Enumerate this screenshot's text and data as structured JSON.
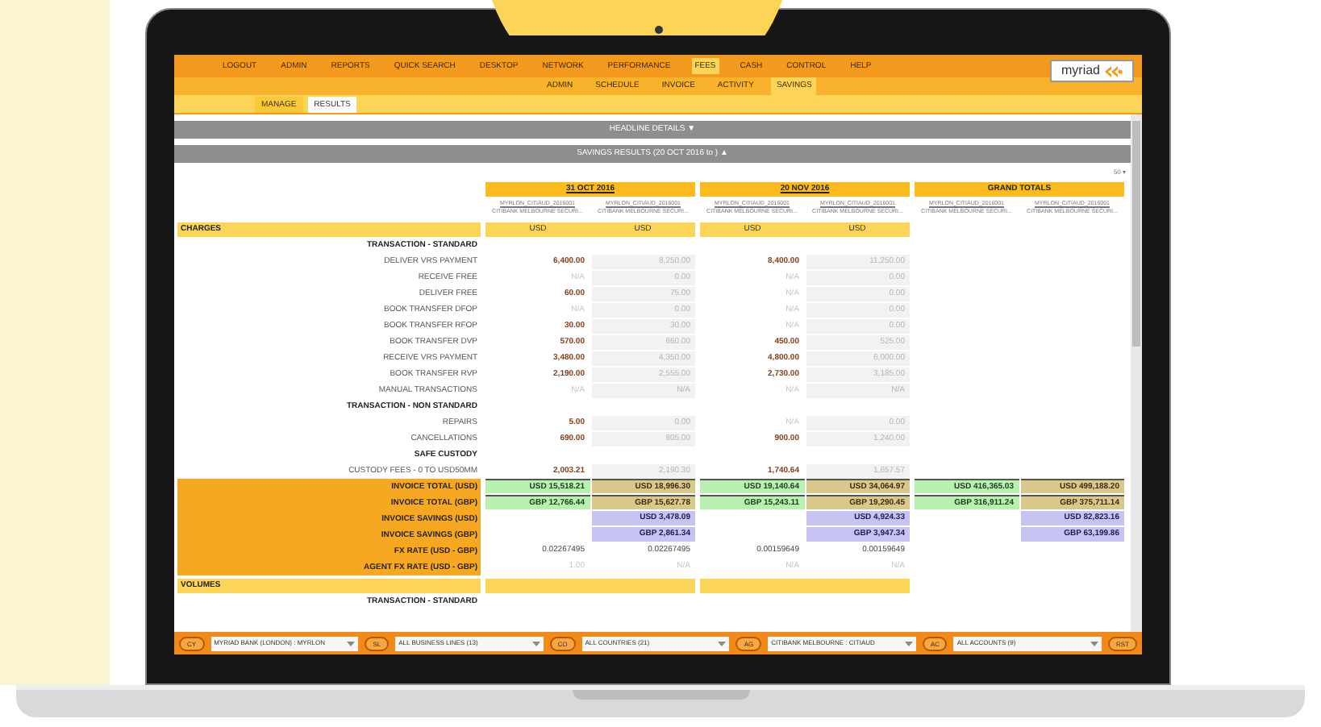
{
  "nav": [
    {
      "label": "LOGOUT",
      "selected": false
    },
    {
      "label": "ADMIN",
      "selected": false
    },
    {
      "label": "REPORTS",
      "selected": false
    },
    {
      "label": "QUICK SEARCH",
      "selected": false
    },
    {
      "label": "DESKTOP",
      "selected": false
    },
    {
      "label": "NETWORK",
      "selected": false
    },
    {
      "label": "PERFORMANCE",
      "selected": false
    },
    {
      "label": "FEES",
      "selected": true
    },
    {
      "label": "CASH",
      "selected": false
    },
    {
      "label": "CONTROL",
      "selected": false
    },
    {
      "label": "HELP",
      "selected": false
    }
  ],
  "subnav": [
    {
      "label": "ADMIN",
      "selected": false
    },
    {
      "label": "SCHEDULE",
      "selected": false
    },
    {
      "label": "INVOICE",
      "selected": false
    },
    {
      "label": "ACTIVITY",
      "selected": false
    },
    {
      "label": "SAVINGS",
      "selected": true
    }
  ],
  "tabs": [
    {
      "label": "MANAGE",
      "selected": false
    },
    {
      "label": "RESULTS",
      "selected": true
    }
  ],
  "logo": "myriad",
  "bars": [
    {
      "label": "HEADLINE DETAILS ▼"
    },
    {
      "label": "SAVINGS RESULTS (20 OCT 2016 to ) ▲"
    }
  ],
  "pager": "50 ▾",
  "groups": [
    {
      "title": "31 OCT 2016",
      "underlined": true
    },
    {
      "title": "20 NOV 2016",
      "underlined": true
    },
    {
      "title": "GRAND TOTALS",
      "underlined": false
    }
  ],
  "accounts": [
    {
      "code": "MYRLON_CITIAUD_2016001",
      "bank": "CITIBANK MELBOURNE SECURI..."
    },
    {
      "code": "MYRLON_CITIAUD_2016001",
      "bank": "CITIBANK MELBOURNE SECURI..."
    },
    {
      "code": "MYRLON_CITIAUD_2016001",
      "bank": "CITIBANK MELBOURNE SECURI..."
    },
    {
      "code": "MYRLON_CITIAUD_2016001",
      "bank": "CITIBANK MELBOURNE SECURI..."
    },
    {
      "code": "MYRLON_CITIAUD_2016001",
      "bank": "CITIBANK MELBOURNE SECURI..."
    },
    {
      "code": "MYRLON_CITIAUD_2016001",
      "bank": "CITIBANK MELBOURNE SECURI..."
    }
  ],
  "rows": [
    {
      "kind": "section",
      "label": "CHARGES",
      "cells": [
        "USD",
        "USD",
        "USD",
        "USD"
      ]
    },
    {
      "kind": "subheader",
      "label": "TRANSACTION - STANDARD"
    },
    {
      "kind": "item",
      "label": "DELIVER VRS PAYMENT",
      "cells": [
        {
          "text": "6,400.00",
          "kind": "value"
        },
        {
          "text": "8,250.00",
          "kind": "prior"
        },
        {
          "text": "8,400.00",
          "kind": "value"
        },
        {
          "text": "11,250.00",
          "kind": "prior"
        }
      ]
    },
    {
      "kind": "item",
      "label": "RECEIVE FREE",
      "cells": [
        {
          "text": "N/A",
          "kind": "muted"
        },
        {
          "text": "0.00",
          "kind": "prior"
        },
        {
          "text": "N/A",
          "kind": "muted"
        },
        {
          "text": "0.00",
          "kind": "prior"
        }
      ]
    },
    {
      "kind": "item",
      "label": "DELIVER FREE",
      "cells": [
        {
          "text": "60.00",
          "kind": "value"
        },
        {
          "text": "75.00",
          "kind": "prior"
        },
        {
          "text": "N/A",
          "kind": "muted"
        },
        {
          "text": "0.00",
          "kind": "prior"
        }
      ]
    },
    {
      "kind": "item",
      "label": "BOOK TRANSFER DFOP",
      "cells": [
        {
          "text": "N/A",
          "kind": "muted"
        },
        {
          "text": "0.00",
          "kind": "prior"
        },
        {
          "text": "N/A",
          "kind": "muted"
        },
        {
          "text": "0.00",
          "kind": "prior"
        }
      ]
    },
    {
      "kind": "item",
      "label": "BOOK TRANSFER RFOP",
      "cells": [
        {
          "text": "30.00",
          "kind": "value"
        },
        {
          "text": "30.00",
          "kind": "prior"
        },
        {
          "text": "N/A",
          "kind": "muted"
        },
        {
          "text": "0.00",
          "kind": "prior"
        }
      ]
    },
    {
      "kind": "item",
      "label": "BOOK TRANSFER DVP",
      "cells": [
        {
          "text": "570.00",
          "kind": "value"
        },
        {
          "text": "660.00",
          "kind": "prior"
        },
        {
          "text": "450.00",
          "kind": "value"
        },
        {
          "text": "525.00",
          "kind": "prior"
        }
      ]
    },
    {
      "kind": "item",
      "label": "RECEIVE VRS PAYMENT",
      "cells": [
        {
          "text": "3,480.00",
          "kind": "value"
        },
        {
          "text": "4,350.00",
          "kind": "prior"
        },
        {
          "text": "4,800.00",
          "kind": "value"
        },
        {
          "text": "6,000.00",
          "kind": "prior"
        }
      ]
    },
    {
      "kind": "item",
      "label": "BOOK TRANSFER RVP",
      "cells": [
        {
          "text": "2,190.00",
          "kind": "value"
        },
        {
          "text": "2,555.00",
          "kind": "prior"
        },
        {
          "text": "2,730.00",
          "kind": "value"
        },
        {
          "text": "3,185.00",
          "kind": "prior"
        }
      ]
    },
    {
      "kind": "item",
      "label": "MANUAL TRANSACTIONS",
      "cells": [
        {
          "text": "N/A",
          "kind": "muted"
        },
        {
          "text": "N/A",
          "kind": "prior"
        },
        {
          "text": "N/A",
          "kind": "muted"
        },
        {
          "text": "N/A",
          "kind": "prior"
        }
      ]
    },
    {
      "kind": "subheader",
      "label": "TRANSACTION - NON STANDARD"
    },
    {
      "kind": "item",
      "label": "REPAIRS",
      "cells": [
        {
          "text": "5.00",
          "kind": "value"
        },
        {
          "text": "0.00",
          "kind": "prior"
        },
        {
          "text": "N/A",
          "kind": "muted"
        },
        {
          "text": "0.00",
          "kind": "prior"
        }
      ]
    },
    {
      "kind": "item",
      "label": "CANCELLATIONS",
      "cells": [
        {
          "text": "690.00",
          "kind": "value"
        },
        {
          "text": "805.00",
          "kind": "prior"
        },
        {
          "text": "900.00",
          "kind": "value"
        },
        {
          "text": "1,240.00",
          "kind": "prior"
        }
      ]
    },
    {
      "kind": "subheader",
      "label": "SAFE CUSTODY"
    },
    {
      "kind": "item",
      "label": "CUSTODY FEES - 0 TO USD50MM",
      "cells": [
        {
          "text": "2,003.21",
          "kind": "value"
        },
        {
          "text": "2,190.30",
          "kind": "prior"
        },
        {
          "text": "1,740.64",
          "kind": "value"
        },
        {
          "text": "1,657.57",
          "kind": "prior"
        }
      ]
    },
    {
      "kind": "total",
      "label": "INVOICE TOTAL (USD)",
      "cells": [
        {
          "text": "USD 15,518.21",
          "kind": "green"
        },
        {
          "text": "USD 18,996.30",
          "kind": "tan"
        },
        {
          "text": "USD 19,140.64",
          "kind": "green"
        },
        {
          "text": "USD 34,064.97",
          "kind": "tan"
        },
        {
          "text": "USD 416,365.03",
          "kind": "green"
        },
        {
          "text": "USD 499,188.20",
          "kind": "tan"
        }
      ]
    },
    {
      "kind": "total",
      "label": "INVOICE TOTAL (GBP)",
      "cells": [
        {
          "text": "GBP 12,766.44",
          "kind": "green"
        },
        {
          "text": "GBP 15,627.78",
          "kind": "tan"
        },
        {
          "text": "GBP 15,243.11",
          "kind": "green"
        },
        {
          "text": "GBP 19,290.45",
          "kind": "tan"
        },
        {
          "text": "GBP 316,911.24",
          "kind": "green"
        },
        {
          "text": "GBP 375,711.14",
          "kind": "tan"
        }
      ]
    },
    {
      "kind": "total",
      "label": "INVOICE SAVINGS (USD)",
      "cells": [
        {
          "kind": "blank"
        },
        {
          "text": "USD 3,478.09",
          "kind": "purple"
        },
        {
          "kind": "blank"
        },
        {
          "text": "USD 4,924.33",
          "kind": "purple"
        },
        {
          "kind": "blank"
        },
        {
          "text": "USD 82,823.16",
          "kind": "purple"
        }
      ]
    },
    {
      "kind": "total",
      "label": "INVOICE SAVINGS (GBP)",
      "cells": [
        {
          "kind": "blank"
        },
        {
          "text": "GBP 2,861.34",
          "kind": "purple"
        },
        {
          "kind": "blank"
        },
        {
          "text": "GBP 3,947.34",
          "kind": "purple"
        },
        {
          "kind": "blank"
        },
        {
          "text": "GBP 63,199.86",
          "kind": "purple"
        }
      ]
    },
    {
      "kind": "total",
      "label": "FX RATE (USD - GBP)",
      "cells": [
        {
          "text": "0.02267495",
          "kind": "rate"
        },
        {
          "text": "0.02267495",
          "kind": "rate"
        },
        {
          "text": "0.00159649",
          "kind": "rate"
        },
        {
          "text": "0.00159649",
          "kind": "rate"
        }
      ]
    },
    {
      "kind": "total",
      "label": "AGENT FX RATE (USD - GBP)",
      "cells": [
        {
          "text": "1.00",
          "kind": "muted"
        },
        {
          "text": "N/A",
          "kind": "muted"
        },
        {
          "text": "N/A",
          "kind": "muted"
        },
        {
          "text": "N/A",
          "kind": "muted"
        }
      ]
    },
    {
      "kind": "section",
      "label": "VOLUMES"
    },
    {
      "kind": "subheader",
      "label": "TRANSACTION - STANDARD"
    }
  ],
  "filters": [
    {
      "button": "CY",
      "value": "MYRIAD BANK (LONDON) : MYRLON"
    },
    {
      "button": "SL",
      "value": "ALL BUSINESS LINES (13)"
    },
    {
      "button": "CO",
      "value": "ALL COUNTRIES (21)"
    },
    {
      "button": "AG",
      "value": "CITIBANK MELBOURNE : CITIAUD"
    },
    {
      "button": "AC",
      "value": "ALL ACCOUNTS (9)"
    }
  ],
  "reset": "RST"
}
